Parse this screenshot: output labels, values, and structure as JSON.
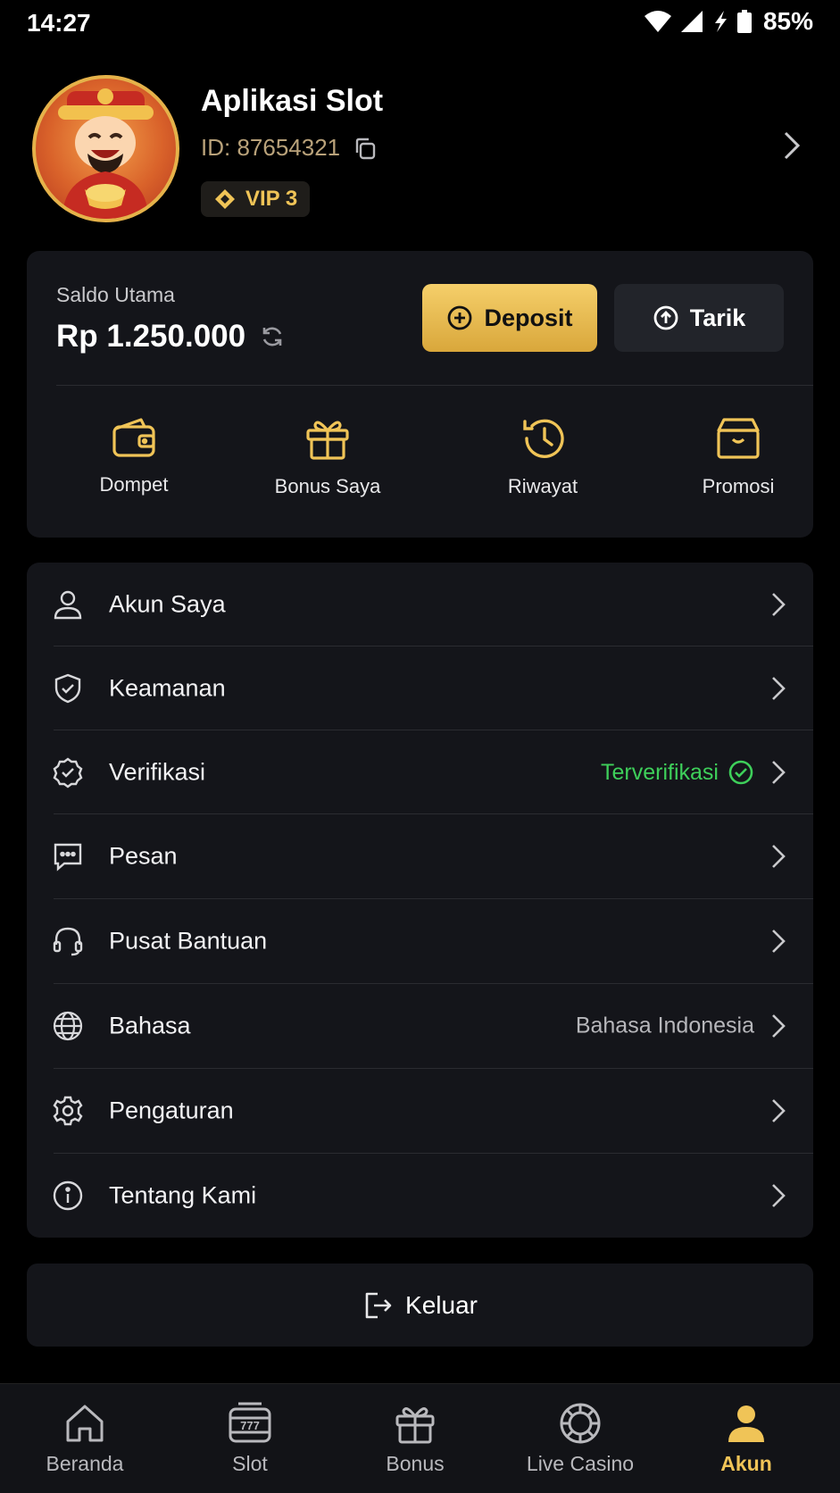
{
  "status_bar": {
    "time": "14:27",
    "battery": "85%"
  },
  "profile": {
    "name": "Aplikasi Slot",
    "id": "ID: 87654321",
    "vip": "VIP 3"
  },
  "balance": {
    "label": "Saldo Utama",
    "amount": "Rp 1.250.000",
    "deposit_label": "Deposit",
    "withdraw_label": "Tarik"
  },
  "quick_actions": [
    {
      "label": "Dompet",
      "icon": "wallet-icon"
    },
    {
      "label": "Bonus Saya",
      "icon": "gift-icon"
    },
    {
      "label": "Riwayat",
      "icon": "history-icon"
    },
    {
      "label": "Promosi",
      "icon": "promo-box-icon"
    }
  ],
  "menu": [
    {
      "label": "Akun Saya",
      "icon": "user-icon",
      "value": ""
    },
    {
      "label": "Keamanan",
      "icon": "shield-icon",
      "value": ""
    },
    {
      "label": "Verifikasi",
      "icon": "badge-check-icon",
      "value": "Terverifikasi"
    },
    {
      "label": "Pesan",
      "icon": "message-icon",
      "value": ""
    },
    {
      "label": "Pusat Bantuan",
      "icon": "headset-icon",
      "value": ""
    },
    {
      "label": "Bahasa",
      "icon": "globe-icon",
      "value": "Bahasa Indonesia"
    },
    {
      "label": "Pengaturan",
      "icon": "gear-icon",
      "value": ""
    },
    {
      "label": "Tentang Kami",
      "icon": "info-icon",
      "value": ""
    }
  ],
  "logout_label": "Keluar",
  "bottom_nav": [
    {
      "label": "Beranda",
      "icon": "home-icon",
      "active": false
    },
    {
      "label": "Slot",
      "icon": "slot-machine-icon",
      "active": false
    },
    {
      "label": "Bonus",
      "icon": "gift-icon",
      "active": false
    },
    {
      "label": "Live Casino",
      "icon": "casino-chip-icon",
      "active": false
    },
    {
      "label": "Akun",
      "icon": "user-icon",
      "active": true
    }
  ],
  "colors": {
    "accent": "#f0c457",
    "verified": "#3ecf5a",
    "card": "#14151a",
    "background": "#000000"
  }
}
